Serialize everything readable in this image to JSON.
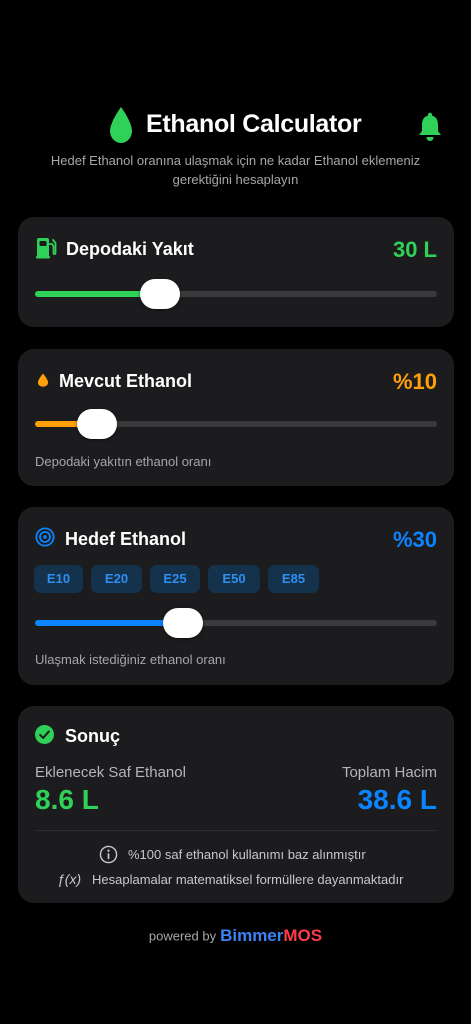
{
  "header": {
    "title": "Ethanol Calculator",
    "subtitle": "Hedef Ethanol oranına ulaşmak için ne kadar Ethanol eklemeniz gerektiğini hesaplayın",
    "logo_icon": "droplet-icon",
    "notification_icon": "bell-icon"
  },
  "colors": {
    "green": "#30d158",
    "orange": "#ff9f0a",
    "blue": "#0a84ff",
    "card": "#1c1c1e",
    "brand_blue": "#3b82f6",
    "brand_red": "#ff3b4a"
  },
  "tank": {
    "label": "Depodaki Yakıt",
    "value": "30 L",
    "icon": "fuel-pump-icon",
    "slider_fraction": 0.31
  },
  "current": {
    "label": "Mevcut Ethanol",
    "value": "%10",
    "hint": "Depodaki yakıtın ethanol oranı",
    "icon": "droplet-icon",
    "slider_fraction": 0.155
  },
  "target": {
    "label": "Hedef Ethanol",
    "value": "%30",
    "hint": "Ulaşmak istediğiniz ethanol oranı",
    "icon": "target-icon",
    "presets": [
      "E10",
      "E20",
      "E25",
      "E50",
      "E85"
    ],
    "slider_fraction": 0.367
  },
  "result": {
    "title": "Sonuç",
    "icon": "check-circle-icon",
    "add_label": "Eklenecek Saf Ethanol",
    "add_value": "8.6 L",
    "total_label": "Toplam Hacim",
    "total_value": "38.6 L",
    "note1": "%100 saf ethanol kullanımı baz alınmıştır",
    "note1_icon": "info-icon",
    "note2": "Hesaplamalar matematiksel formüllere dayanmaktadır",
    "note2_icon": "function-icon",
    "note2_symbol": "ƒ(x)"
  },
  "footer": {
    "powered_by": "powered by",
    "brand_part1": "Bimmer",
    "brand_part2": "MOS"
  }
}
